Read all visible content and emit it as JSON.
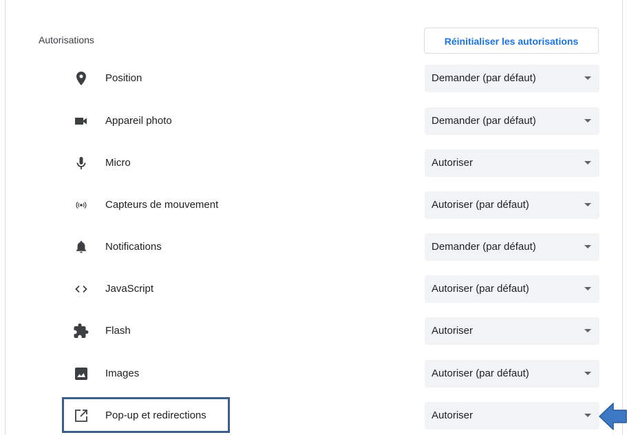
{
  "permissions_section": {
    "title": "Autorisations",
    "reset_button_label": "Réinitialiser les autorisations"
  },
  "permissions": [
    {
      "icon": "location-pin-icon",
      "label": "Position",
      "value": "Demander (par défaut)"
    },
    {
      "icon": "camera-icon",
      "label": "Appareil photo",
      "value": "Demander (par défaut)"
    },
    {
      "icon": "microphone-icon",
      "label": "Micro",
      "value": "Autoriser"
    },
    {
      "icon": "motion-sensors-icon",
      "label": "Capteurs de mouvement",
      "value": "Autoriser (par défaut)"
    },
    {
      "icon": "bell-icon",
      "label": "Notifications",
      "value": "Demander (par défaut)"
    },
    {
      "icon": "code-brackets-icon",
      "label": "JavaScript",
      "value": "Autoriser (par défaut)"
    },
    {
      "icon": "puzzle-piece-icon",
      "label": "Flash",
      "value": "Autoriser"
    },
    {
      "icon": "image-icon",
      "label": "Images",
      "value": "Autoriser (par défaut)"
    },
    {
      "icon": "open-in-new-icon",
      "label": "Pop-up et redirections",
      "value": "Autoriser"
    }
  ],
  "annotation": {
    "highlighted_row": "Pop-up et redirections",
    "outline_color": "#3b5f8a",
    "arrow_color": "#3d78c4"
  },
  "colors": {
    "accent": "#1a73e8",
    "select_background": "#f1f3f4",
    "icon_color": "#5f6368"
  }
}
